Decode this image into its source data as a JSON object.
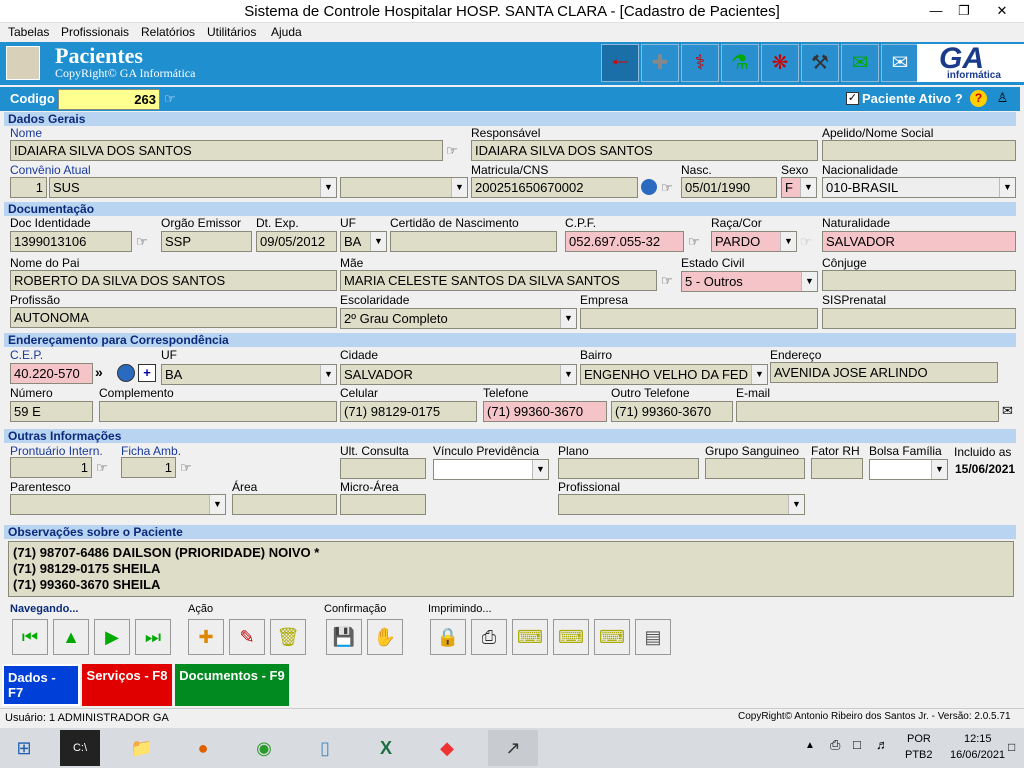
{
  "window": {
    "title": "Sistema de Controle Hospitalar HOSP. SANTA CLARA - [Cadastro de Pacientes]"
  },
  "menu": [
    "Tabelas",
    "Profissionais",
    "Relatórios",
    "Utilitários",
    "Ajuda"
  ],
  "banner": {
    "title": "Pacientes",
    "subtitle": "CopyRight© GA Informática",
    "logo_text": "GA",
    "logo_sub": "informática"
  },
  "code": {
    "label": "Codigo",
    "value": "263",
    "active_label": "Paciente Ativo ?",
    "active": true
  },
  "sections": {
    "gerais": "Dados Gerais",
    "doc": "Documentação",
    "end": "Endereçamento para Correspondência",
    "outras": "Outras Informações",
    "obs": "Observações sobre o Paciente"
  },
  "gerais": {
    "nome_l": "Nome",
    "nome": "IDAIARA SILVA DOS SANTOS",
    "resp_l": "Responsável",
    "resp": "IDAIARA SILVA DOS SANTOS",
    "apelido_l": "Apelido/Nome Social",
    "apelido": "",
    "conv_l": "Convênio Atual",
    "conv_num": "1",
    "conv": "SUS",
    "conv2": "",
    "matr_l": "Matricula/CNS",
    "matr": "200251650670002",
    "nasc_l": "Nasc.",
    "nasc": "05/01/1990",
    "sexo_l": "Sexo",
    "sexo": "F",
    "nac_l": "Nacionalidade",
    "nac": "010-BRASIL"
  },
  "doc": {
    "rg_l": "Doc Identidade",
    "rg": "1399013106",
    "org_l": "Orgão Emissor",
    "org": "SSP",
    "dt_l": "Dt. Exp.",
    "dt": "09/05/2012",
    "uf_l": "UF",
    "uf": "BA",
    "cert_l": "Certidão de Nascimento",
    "cert": "",
    "cpf_l": "C.P.F.",
    "cpf": "052.697.055-32",
    "raca_l": "Raça/Cor",
    "raca": "PARDO",
    "nat_l": "Naturalidade",
    "nat": "SALVADOR",
    "pai_l": "Nome do Pai",
    "pai": "ROBERTO DA SILVA DOS SANTOS",
    "mae_l": "Mãe",
    "mae": "MARIA CELESTE SANTOS DA SILVA SANTOS",
    "civil_l": "Estado Civil",
    "civil": "5 - Outros",
    "conj_l": "Cônjuge",
    "conj": "",
    "prof_l": "Profissão",
    "prof": "AUTONOMA",
    "esc_l": "Escolaridade",
    "esc": "2º Grau Completo",
    "emp_l": "Empresa",
    "emp": "",
    "sis_l": "SISPrenatal",
    "sis": ""
  },
  "end": {
    "cep_l": "C.E.P.",
    "cep": "40.220-570",
    "uf_l": "UF",
    "uf": "BA",
    "cid_l": "Cidade",
    "cid": "SALVADOR",
    "bairro_l": "Bairro",
    "bairro": "ENGENHO VELHO DA FED",
    "endr_l": "Endereço",
    "endr": "AVENIDA JOSE ARLINDO",
    "num_l": "Número",
    "num": "59 E",
    "comp_l": "Complemento",
    "comp": "",
    "cel_l": "Celular",
    "cel": "(71) 98129-0175",
    "tel_l": "Telefone",
    "tel": "(71) 99360-3670",
    "otel_l": "Outro Telefone",
    "otel": "(71) 99360-3670",
    "email_l": "E-mail",
    "email": ""
  },
  "outras": {
    "pront_l": "Prontuário Intern.",
    "pront": "1",
    "ficha_l": "Ficha Amb.",
    "ficha": "1",
    "ult_l": "Ult. Consulta",
    "ult": "",
    "vinc_l": "Vínculo Previdência",
    "vinc": "",
    "plano_l": "Plano",
    "plano": "",
    "grupo_l": "Grupo Sanguineo",
    "grupo": "",
    "fator_l": "Fator RH",
    "fator": "",
    "bolsa_l": "Bolsa Família",
    "bolsa": "",
    "incl_l": "Incluido as",
    "incl": "15/06/2021",
    "par_l": "Parentesco",
    "par": "",
    "area_l": "Área",
    "area": "",
    "micro_l": "Micro-Área",
    "micro": "",
    "profis_l": "Profissional",
    "profis": ""
  },
  "obs": [
    "(71) 98707-6486 DAILSON (PRIORIDADE) NOIVO *",
    "(71) 98129-0175 SHEILA",
    "(71) 99360-3670 SHEILA"
  ],
  "groups": {
    "nav": "Navegando...",
    "acao": "Ação",
    "conf": "Confirmação",
    "imp": "Imprimindo..."
  },
  "tabs": {
    "dados": "Dados - F7",
    "serv": "Serviços - F8",
    "docs": "Documentos - F9"
  },
  "status": {
    "user": "Usuário: 1  ADMINISTRADOR GA",
    "copy": "CopyRight© Antonio Ribeiro dos Santos Jr. - Versão: 2.0.5.71"
  },
  "taskbar": {
    "lang": "POR",
    "layout": "PTB2",
    "time": "12:15",
    "date": "16/06/2021"
  },
  "colors": {
    "banner": "#1f8fd0",
    "section": "#b8d4f0",
    "field": "#ddddc8",
    "required": "#f4c4c8"
  }
}
